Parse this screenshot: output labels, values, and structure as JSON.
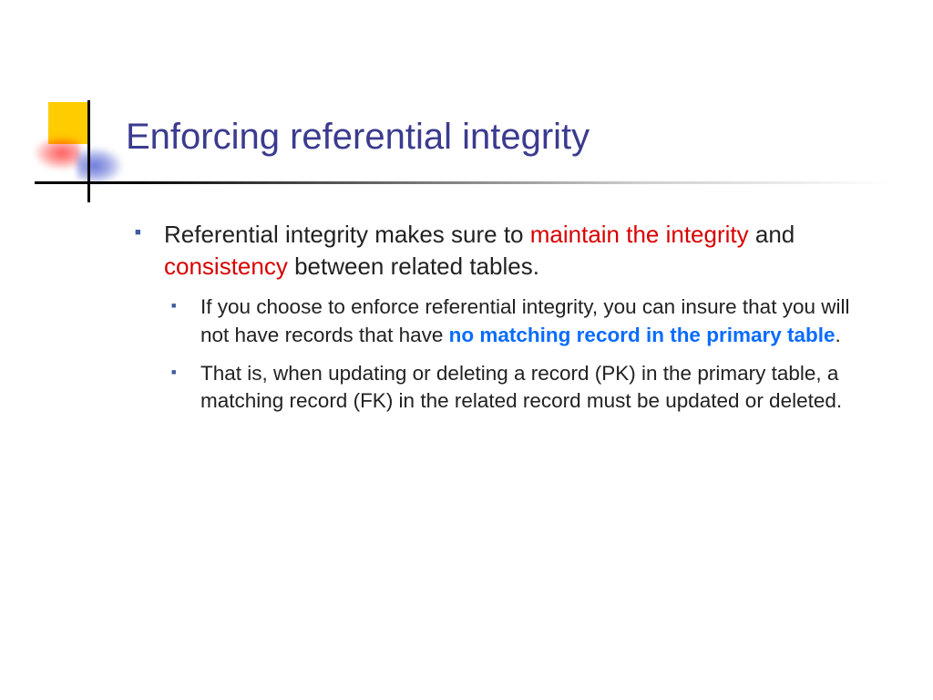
{
  "slide": {
    "title": "Enforcing referential integrity",
    "bullet1": {
      "p1": "Referential integrity makes sure to ",
      "r1": "maintain the integrity",
      "p2": " and ",
      "r2": "consistency",
      "p3": " between related tables."
    },
    "sub1": {
      "p1": "If you choose to enforce referential integrity, you can insure that you will not have records that have ",
      "b1": "no matching record in the primary table",
      "p2": "."
    },
    "sub2": {
      "p1": "That is, when ",
      "p2": "updating or deleting a record (PK) in the primary table, a matching record (FK) in the related record must be updated or deleted."
    }
  }
}
